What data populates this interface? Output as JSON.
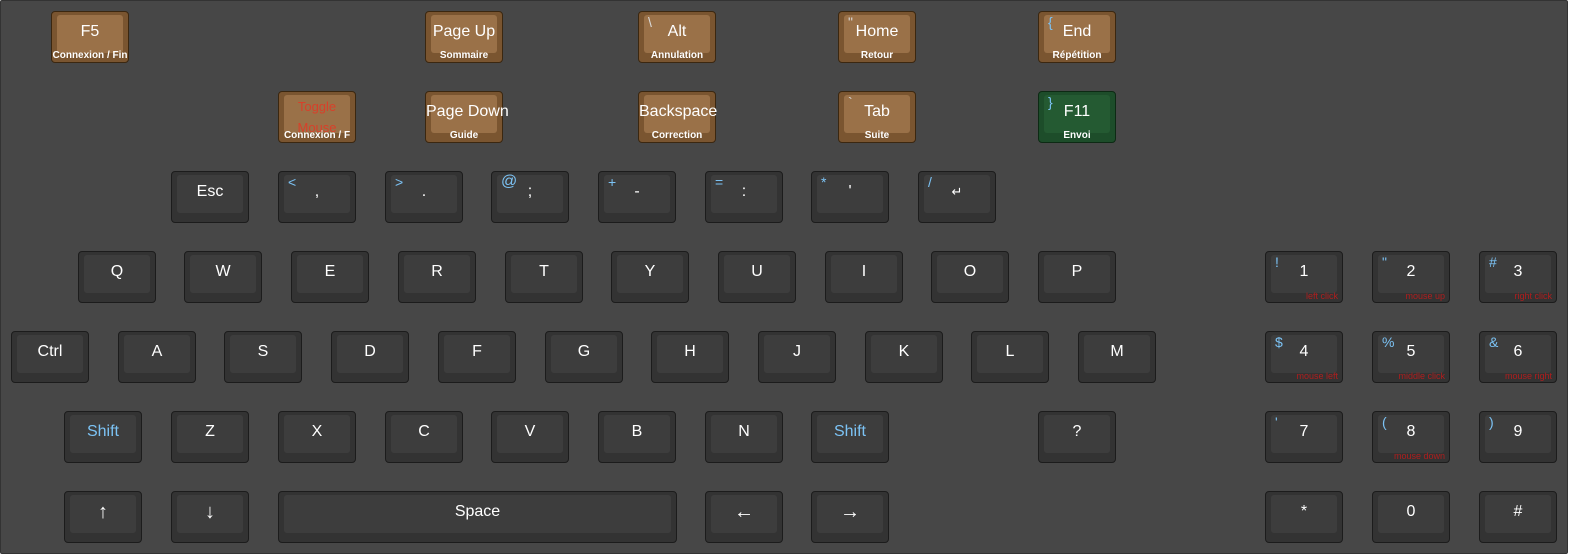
{
  "colors": {
    "panel": "#474747",
    "key": "#333333",
    "key_face": "#3d3d3d",
    "function_key": "#9a7148",
    "send_key": "#245a32",
    "secondary_text": "#7cc3f5",
    "mouse_hint": "#b01e1e"
  },
  "function_keys": {
    "f5": {
      "label": "F5",
      "caption": "Connexion / Fin"
    },
    "toggle_mouse": {
      "label": "Toggle Mouse",
      "caption": "Connexion / F"
    },
    "page_up": {
      "label": "Page Up",
      "caption": "Sommaire"
    },
    "page_down": {
      "label": "Page Down",
      "caption": "Guide"
    },
    "alt": {
      "label": "Alt",
      "caption": "Annulation",
      "secondary": "\\"
    },
    "backspace": {
      "label": "Backspace",
      "caption": "Correction"
    },
    "home": {
      "label": "Home",
      "caption": "Retour",
      "secondary": "\""
    },
    "tab": {
      "label": "Tab",
      "caption": "Suite",
      "secondary": "`"
    },
    "end": {
      "label": "End",
      "caption": "Répétition",
      "secondary": "{"
    },
    "f11": {
      "label": "F11",
      "caption": "Envoi",
      "secondary": "}"
    }
  },
  "punctuation_row": {
    "esc": "Esc",
    "keys": [
      {
        "main": ",",
        "secondary": "<"
      },
      {
        "main": ".",
        "secondary": ">"
      },
      {
        "main": ";",
        "secondary": "@"
      },
      {
        "main": "-",
        "secondary": "+"
      },
      {
        "main": ":",
        "secondary": "="
      },
      {
        "main": "'",
        "secondary": "*"
      },
      {
        "main": "↵",
        "secondary": "/"
      }
    ]
  },
  "rows": {
    "qwerty": [
      "Q",
      "W",
      "E",
      "R",
      "T",
      "Y",
      "U",
      "I",
      "O",
      "P"
    ],
    "home": [
      "A",
      "S",
      "D",
      "F",
      "G",
      "H",
      "J",
      "K",
      "L",
      "M"
    ],
    "bottom": [
      "Z",
      "X",
      "C",
      "V",
      "B",
      "N"
    ]
  },
  "modifiers": {
    "ctrl": "Ctrl",
    "shift_left": "Shift",
    "shift_right": "Shift",
    "question": "?",
    "space": "Space",
    "arrow_up": "↑",
    "arrow_down": "↓",
    "arrow_left": "←",
    "arrow_right": "→"
  },
  "numpad": [
    {
      "main": "1",
      "secondary": "!",
      "hint": "left click"
    },
    {
      "main": "2",
      "secondary": "\"",
      "hint": "mouse up"
    },
    {
      "main": "3",
      "secondary": "#",
      "hint": "right click"
    },
    {
      "main": "4",
      "secondary": "$",
      "hint": "mouse left"
    },
    {
      "main": "5",
      "secondary": "%",
      "hint": "middle click"
    },
    {
      "main": "6",
      "secondary": "&",
      "hint": "mouse right"
    },
    {
      "main": "7",
      "secondary": "'",
      "hint": ""
    },
    {
      "main": "8",
      "secondary": "(",
      "hint": "mouse down"
    },
    {
      "main": "9",
      "secondary": ")",
      "hint": ""
    },
    {
      "main": "*",
      "secondary": "",
      "hint": ""
    },
    {
      "main": "0",
      "secondary": "",
      "hint": ""
    },
    {
      "main": "#",
      "secondary": "",
      "hint": ""
    }
  ]
}
